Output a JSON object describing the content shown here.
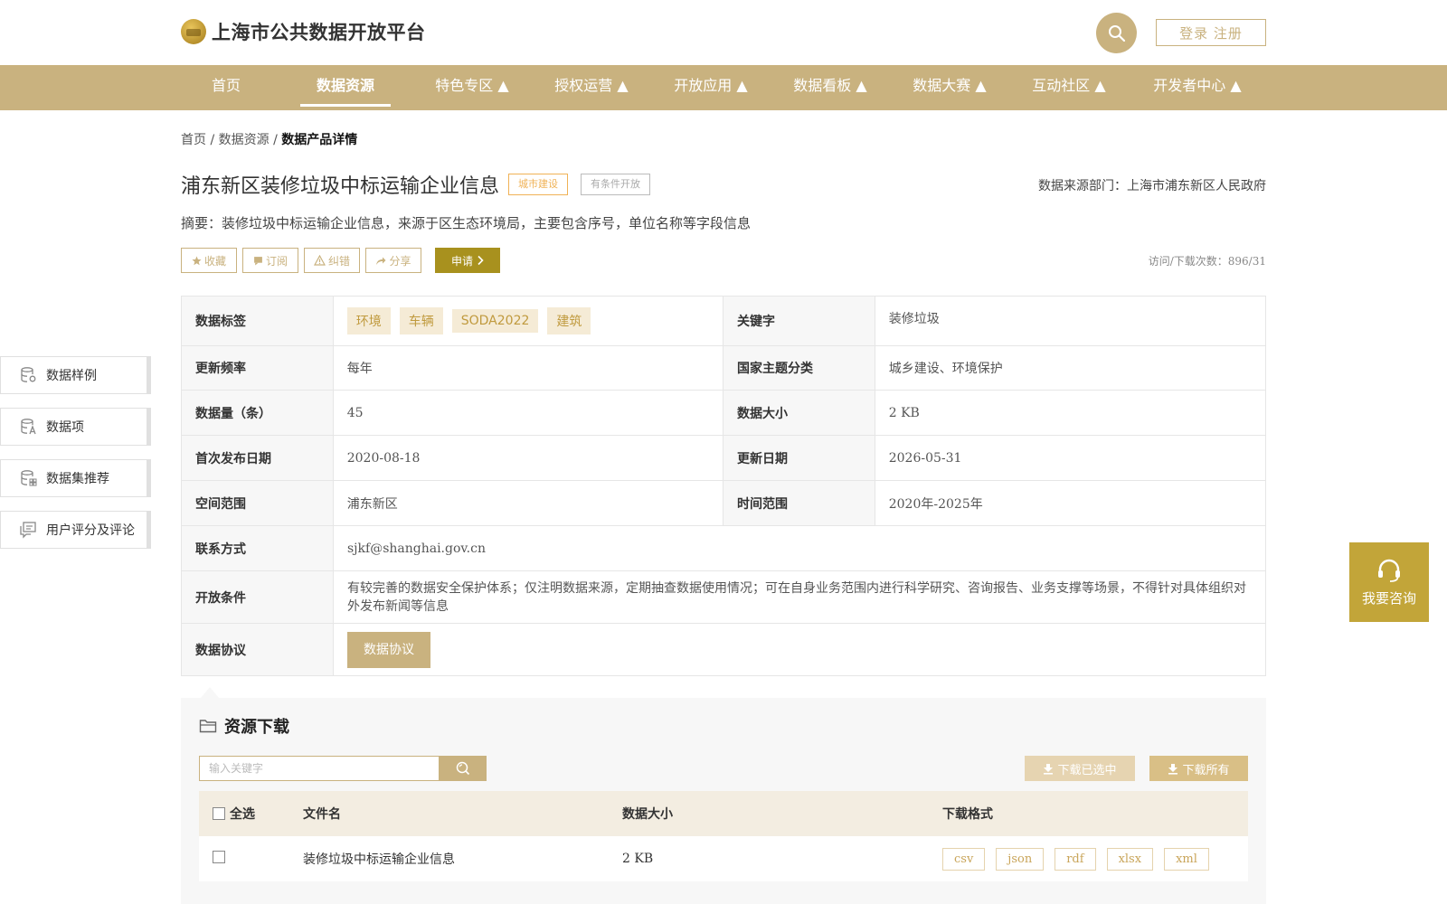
{
  "header": {
    "site_title": "上海市公共数据开放平台",
    "login": "登录 注册",
    "icons": {
      "logo": "logo-icon",
      "search": "search-icon"
    }
  },
  "nav": [
    "首页",
    "数据资源",
    "特色专区 ▲",
    "授权运营 ▲",
    "开放应用 ▲",
    "数据看板 ▲",
    "数据大赛 ▲",
    "互动社区 ▲",
    "开发者中心 ▲"
  ],
  "nav_active": "数据资源",
  "breadcrumb": {
    "home": "首页",
    "sep1": " / ",
    "resources": "数据资源",
    "sep2": " / ",
    "current": "数据产品详情"
  },
  "dataset": {
    "title": "浦东新区装修垃圾中标运输企业信息",
    "tag_category": "城市建设",
    "tag_open": "有条件开放",
    "source": "数据来源部门：上海市浦东新区人民政府",
    "summary": "摘要：装修垃圾中标运输企业信息，来源于区生态环境局，主要包含序号，单位名称等字段信息",
    "visits": "访问/下载次数：896/31"
  },
  "actions": {
    "favorite": "收藏",
    "subscribe": "订阅",
    "correct": "纠错",
    "share": "分享",
    "apply": "申请"
  },
  "info": {
    "labels_tag": "数据标签",
    "tags": [
      "环境",
      "车辆",
      "SODA2022",
      "建筑"
    ],
    "label_keyword": "关键字",
    "keyword": "装修垃圾",
    "label_freq": "更新频率",
    "freq": "每年",
    "label_theme": "国家主题分类",
    "theme": "城乡建设、环境保护",
    "label_count": "数据量（条）",
    "count": "45",
    "label_size": "数据大小",
    "size": "2 KB",
    "label_first": "首次发布日期",
    "first": "2020-08-18",
    "label_update": "更新日期",
    "update": "2026-05-31",
    "label_space": "空间范围",
    "space": "浦东新区",
    "label_time": "时间范围",
    "time": "2020年-2025年",
    "label_contact": "联系方式",
    "contact": "sjkf@shanghai.gov.cn",
    "label_cond": "开放条件",
    "cond": "有较完善的数据安全保护体系；仅注明数据来源，定期抽查数据使用情况；可在自身业务范围内进行科学研究、咨询报告、业务支撑等场景，不得针对具体组织对外发布新闻等信息",
    "label_proto": "数据协议",
    "proto_btn": "数据协议"
  },
  "side_menu": [
    "数据样例",
    "数据项",
    "数据集推荐",
    "用户评分及评论"
  ],
  "consult": "我要咨询",
  "resources": {
    "title": "资源下载",
    "search_placeholder": "输入关键字",
    "download_selected": "下载已选中",
    "download_all": "下载所有",
    "columns": [
      "全选",
      "文件名",
      "数据大小",
      "下载格式"
    ],
    "files": [
      {
        "name": "装修垃圾中标运输企业信息",
        "size": "2 KB",
        "formats": [
          "csv",
          "json",
          "rdf",
          "xlsx",
          "xml"
        ]
      }
    ]
  },
  "colors": {
    "brand": "#c9b27f",
    "apply": "#a8911e",
    "consult": "#c2a539",
    "tag_orange": "#f0b256",
    "tag_grey": "#aaaaaa"
  }
}
